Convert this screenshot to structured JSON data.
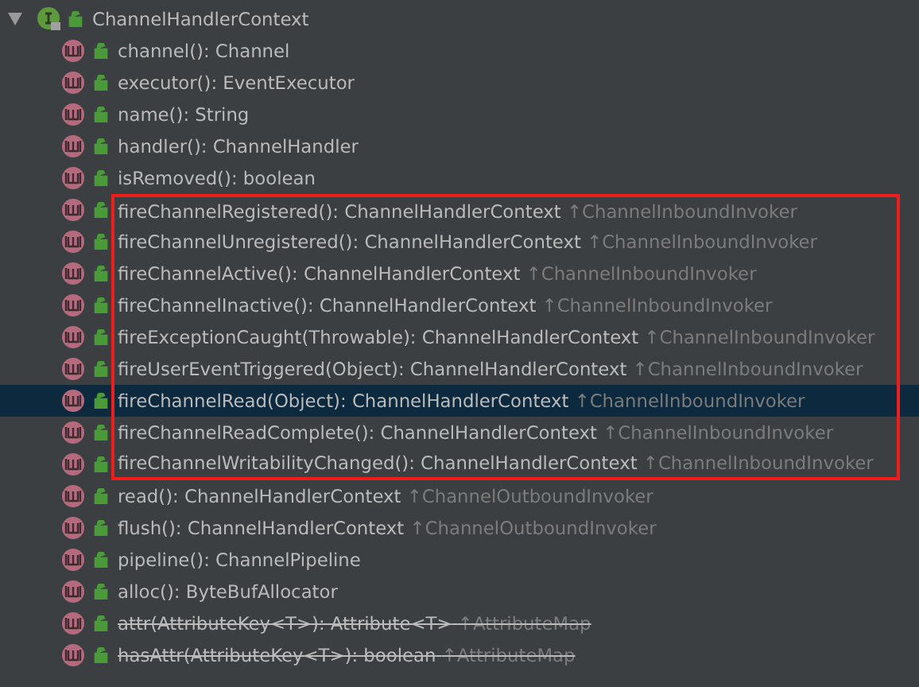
{
  "tree": {
    "label": "ChannelHandlerContext",
    "expanded": true,
    "children": [
      {
        "signature": "channel(): Channel",
        "highlighted": false,
        "selected": false,
        "deprecated": false
      },
      {
        "signature": "executor(): EventExecutor",
        "highlighted": false,
        "selected": false,
        "deprecated": false
      },
      {
        "signature": "name(): String",
        "highlighted": false,
        "selected": false,
        "deprecated": false
      },
      {
        "signature": "handler(): ChannelHandler",
        "highlighted": false,
        "selected": false,
        "deprecated": false
      },
      {
        "signature": "isRemoved(): boolean",
        "highlighted": false,
        "selected": false,
        "deprecated": false
      },
      {
        "signature": "fireChannelRegistered(): ChannelHandlerContext",
        "inherited": "↑ChannelInboundInvoker",
        "highlighted": true,
        "selected": false,
        "deprecated": false
      },
      {
        "signature": "fireChannelUnregistered(): ChannelHandlerContext",
        "inherited": "↑ChannelInboundInvoker",
        "highlighted": true,
        "selected": false,
        "deprecated": false
      },
      {
        "signature": "fireChannelActive(): ChannelHandlerContext",
        "inherited": "↑ChannelInboundInvoker",
        "highlighted": true,
        "selected": false,
        "deprecated": false
      },
      {
        "signature": "fireChannelInactive(): ChannelHandlerContext",
        "inherited": "↑ChannelInboundInvoker",
        "highlighted": true,
        "selected": false,
        "deprecated": false
      },
      {
        "signature": "fireExceptionCaught(Throwable): ChannelHandlerContext",
        "inherited": "↑ChannelInboundInvoker",
        "highlighted": true,
        "selected": false,
        "deprecated": false
      },
      {
        "signature": "fireUserEventTriggered(Object): ChannelHandlerContext",
        "inherited": "↑ChannelInboundInvoker",
        "highlighted": true,
        "selected": false,
        "deprecated": false
      },
      {
        "signature": "fireChannelRead(Object): ChannelHandlerContext",
        "inherited": "↑ChannelInboundInvoker",
        "highlighted": true,
        "selected": true,
        "deprecated": false
      },
      {
        "signature": "fireChannelReadComplete(): ChannelHandlerContext",
        "inherited": "↑ChannelInboundInvoker",
        "highlighted": true,
        "selected": false,
        "deprecated": false
      },
      {
        "signature": "fireChannelWritabilityChanged(): ChannelHandlerContext",
        "inherited": "↑ChannelInboundInvoker",
        "highlighted": true,
        "selected": false,
        "deprecated": false
      },
      {
        "signature": "read(): ChannelHandlerContext",
        "inherited": "↑ChannelOutboundInvoker",
        "highlighted": false,
        "selected": false,
        "deprecated": false
      },
      {
        "signature": "flush(): ChannelHandlerContext",
        "inherited": "↑ChannelOutboundInvoker",
        "highlighted": false,
        "selected": false,
        "deprecated": false
      },
      {
        "signature": "pipeline(): ChannelPipeline",
        "highlighted": false,
        "selected": false,
        "deprecated": false
      },
      {
        "signature": "alloc(): ByteBufAllocator",
        "highlighted": false,
        "selected": false,
        "deprecated": false
      },
      {
        "signature": "attr(AttributeKey<T>): Attribute<T>",
        "inherited": "↑AttributeMap",
        "highlighted": false,
        "selected": false,
        "deprecated": true
      },
      {
        "signature": "hasAttr(AttributeKey<T>): boolean",
        "inherited": "↑AttributeMap",
        "highlighted": false,
        "selected": false,
        "deprecated": true
      }
    ]
  }
}
